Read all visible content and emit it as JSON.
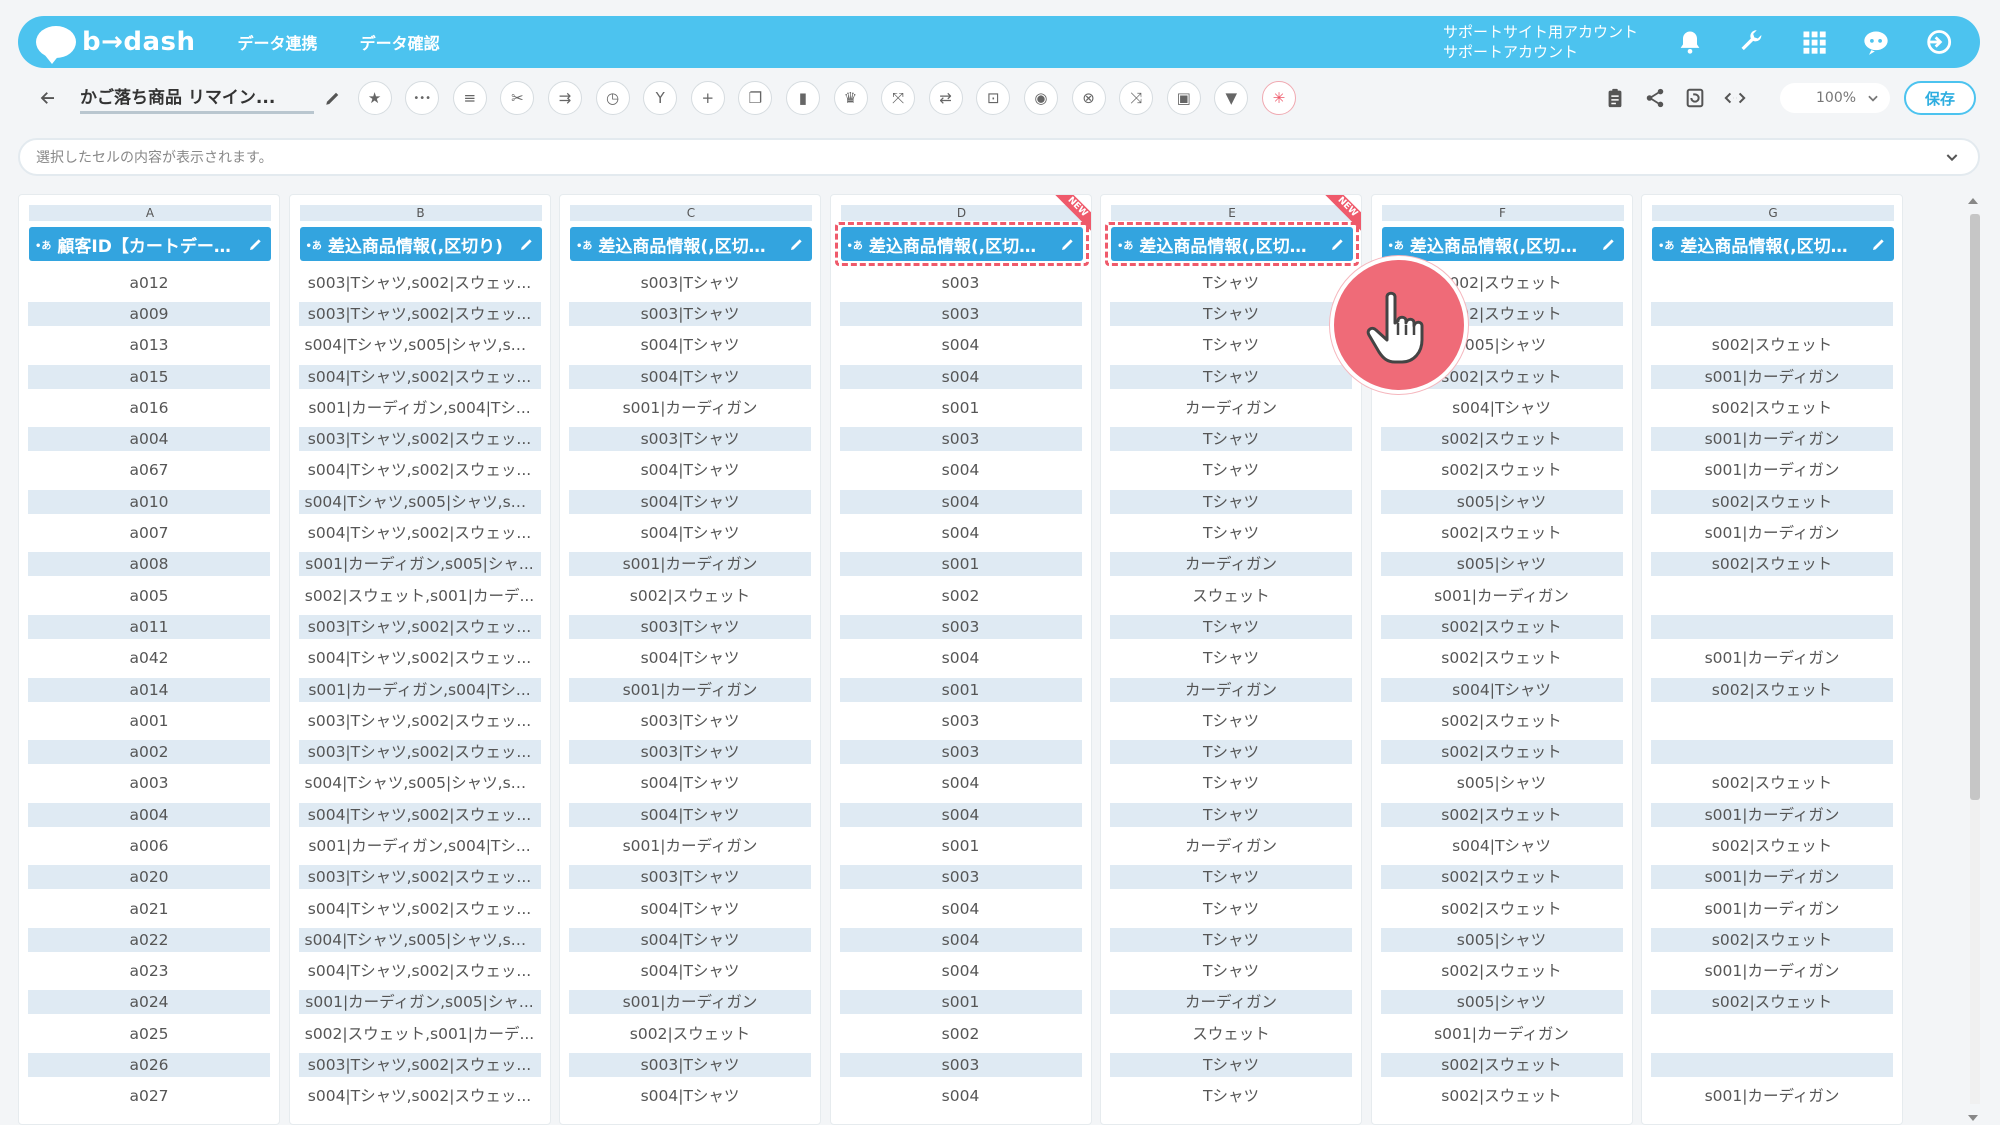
{
  "app": {
    "logo": "b→dash",
    "nav": [
      "データ連携",
      "データ確認"
    ],
    "account_line1": "サポートサイト用アカウント",
    "account_line2": "サポートアカウント"
  },
  "toolbar": {
    "title": "かご落ち商品 リマイン...",
    "zoom": "100%",
    "save_label": "保存"
  },
  "cellbar": {
    "placeholder": "選択したセルの内容が表示されます。"
  },
  "columns": [
    {
      "letter": "A",
      "type": "•あ",
      "header": "顧客ID【カートデー…",
      "new": false,
      "selected": false,
      "cells": [
        "a012",
        "a009",
        "a013",
        "a015",
        "a016",
        "a004",
        "a067",
        "a010",
        "a007",
        "a008",
        "a005",
        "a011",
        "a042",
        "a014",
        "a001",
        "a002",
        "a003",
        "a004",
        "a006",
        "a020",
        "a021",
        "a022",
        "a023",
        "a024",
        "a025",
        "a026",
        "a027"
      ]
    },
    {
      "letter": "B",
      "type": "•あ",
      "header": "差込商品情報(,区切り)",
      "new": false,
      "selected": false,
      "cells": [
        "s003|Tシャツ,s002|スウェッ...",
        "s003|Tシャツ,s002|スウェッ...",
        "s004|Tシャツ,s005|シャツ,s0...",
        "s004|Tシャツ,s002|スウェッ...",
        "s001|カーディガン,s004|Tシ...",
        "s003|Tシャツ,s002|スウェッ...",
        "s004|Tシャツ,s002|スウェッ...",
        "s004|Tシャツ,s005|シャツ,s0...",
        "s004|Tシャツ,s002|スウェッ...",
        "s001|カーディガン,s005|シャ...",
        "s002|スウェット,s001|カーデ...",
        "s003|Tシャツ,s002|スウェッ...",
        "s004|Tシャツ,s002|スウェッ...",
        "s001|カーディガン,s004|Tシ...",
        "s003|Tシャツ,s002|スウェッ...",
        "s003|Tシャツ,s002|スウェッ...",
        "s004|Tシャツ,s005|シャツ,s0...",
        "s004|Tシャツ,s002|スウェッ...",
        "s001|カーディガン,s004|Tシ...",
        "s003|Tシャツ,s002|スウェッ...",
        "s004|Tシャツ,s002|スウェッ...",
        "s004|Tシャツ,s005|シャツ,s0...",
        "s004|Tシャツ,s002|スウェッ...",
        "s001|カーディガン,s005|シャ...",
        "s002|スウェット,s001|カーデ...",
        "s003|Tシャツ,s002|スウェッ...",
        "s004|Tシャツ,s002|スウェッ..."
      ]
    },
    {
      "letter": "C",
      "type": "•あ",
      "header": "差込商品情報(,区切…",
      "new": false,
      "selected": false,
      "cells": [
        "s003|Tシャツ",
        "s003|Tシャツ",
        "s004|Tシャツ",
        "s004|Tシャツ",
        "s001|カーディガン",
        "s003|Tシャツ",
        "s004|Tシャツ",
        "s004|Tシャツ",
        "s004|Tシャツ",
        "s001|カーディガン",
        "s002|スウェット",
        "s003|Tシャツ",
        "s004|Tシャツ",
        "s001|カーディガン",
        "s003|Tシャツ",
        "s003|Tシャツ",
        "s004|Tシャツ",
        "s004|Tシャツ",
        "s001|カーディガン",
        "s003|Tシャツ",
        "s004|Tシャツ",
        "s004|Tシャツ",
        "s004|Tシャツ",
        "s001|カーディガン",
        "s002|スウェット",
        "s003|Tシャツ",
        "s004|Tシャツ"
      ]
    },
    {
      "letter": "D",
      "type": "•あ",
      "header": "差込商品情報(,区切…",
      "new": true,
      "selected": true,
      "cells": [
        "s003",
        "s003",
        "s004",
        "s004",
        "s001",
        "s003",
        "s004",
        "s004",
        "s004",
        "s001",
        "s002",
        "s003",
        "s004",
        "s001",
        "s003",
        "s003",
        "s004",
        "s004",
        "s001",
        "s003",
        "s004",
        "s004",
        "s004",
        "s001",
        "s002",
        "s003",
        "s004"
      ]
    },
    {
      "letter": "E",
      "type": "•あ",
      "header": "差込商品情報(,区切…",
      "new": true,
      "selected": true,
      "cells": [
        "Tシャツ",
        "Tシャツ",
        "Tシャツ",
        "Tシャツ",
        "カーディガン",
        "Tシャツ",
        "Tシャツ",
        "Tシャツ",
        "Tシャツ",
        "カーディガン",
        "スウェット",
        "Tシャツ",
        "Tシャツ",
        "カーディガン",
        "Tシャツ",
        "Tシャツ",
        "Tシャツ",
        "Tシャツ",
        "カーディガン",
        "Tシャツ",
        "Tシャツ",
        "Tシャツ",
        "Tシャツ",
        "カーディガン",
        "スウェット",
        "Tシャツ",
        "Tシャツ"
      ]
    },
    {
      "letter": "F",
      "type": "•あ",
      "header": "差込商品情報(,区切…",
      "new": false,
      "selected": false,
      "cells": [
        "s002|スウェット",
        "s002|スウェット",
        "s005|シャツ",
        "s002|スウェット",
        "s004|Tシャツ",
        "s002|スウェット",
        "s002|スウェット",
        "s005|シャツ",
        "s002|スウェット",
        "s005|シャツ",
        "s001|カーディガン",
        "s002|スウェット",
        "s002|スウェット",
        "s004|Tシャツ",
        "s002|スウェット",
        "s002|スウェット",
        "s005|シャツ",
        "s002|スウェット",
        "s004|Tシャツ",
        "s002|スウェット",
        "s002|スウェット",
        "s005|シャツ",
        "s002|スウェット",
        "s005|シャツ",
        "s001|カーディガン",
        "s002|スウェット",
        "s002|スウェット"
      ]
    },
    {
      "letter": "G",
      "type": "•あ",
      "header": "差込商品情報(,区切…",
      "new": false,
      "selected": false,
      "cells": [
        "",
        "",
        "s002|スウェット",
        "s001|カーディガン",
        "s002|スウェット",
        "s001|カーディガン",
        "s001|カーディガン",
        "s002|スウェット",
        "s001|カーディガン",
        "s002|スウェット",
        "",
        "",
        "s001|カーディガン",
        "s002|スウェット",
        "",
        "",
        "s002|スウェット",
        "s001|カーディガン",
        "s002|スウェット",
        "s001|カーディガン",
        "s001|カーディガン",
        "s002|スウェット",
        "s001|カーディガン",
        "s002|スウェット",
        "",
        "",
        "s001|カーディガン"
      ]
    }
  ],
  "new_badge": "NEW",
  "colors": {
    "topbar": "#4cc3ef",
    "header": "#33a4df",
    "shade": "#dfeaf3",
    "highlight": "#ef5a6b"
  },
  "icons": {
    "top": [
      "bell-icon",
      "wrench-icon",
      "grid-apps-icon",
      "chat-bot-icon",
      "logout-icon"
    ],
    "tools": [
      "star-icon",
      "more-icon",
      "list-icon",
      "scissors-icon",
      "merge-icon",
      "timer-icon",
      "branch-icon",
      "add-icon",
      "copy-icon",
      "trash-icon",
      "crown-icon",
      "expand-icon",
      "swap-icon",
      "lock-icon",
      "bag-icon",
      "clear-icon",
      "shuffle-icon",
      "frame-icon",
      "filter-icon",
      "ai-icon"
    ],
    "tools_right": [
      "clipboard-icon",
      "share-icon",
      "refresh-icon",
      "code-icon"
    ]
  }
}
